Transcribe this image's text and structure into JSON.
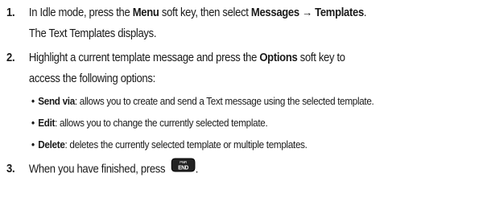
{
  "steps": [
    {
      "number": "1.",
      "line1": {
        "pre": "In Idle mode, press the ",
        "b1": "Menu",
        "mid": " soft key, then select ",
        "b2": "Messages",
        "arrow": " → ",
        "b3": "Templates",
        "end": "."
      },
      "line2": "The Text Templates displays."
    },
    {
      "number": "2.",
      "line1": {
        "pre": "Highlight a current template message and press the ",
        "b1": "Options",
        "end": " soft key to"
      },
      "line2": "access the following options:",
      "bullets": [
        {
          "term": "Send via",
          "desc": ": allows you to create and send a Text message using the selected template."
        },
        {
          "term": "Edit",
          "desc": ": allows you to change the currently selected template."
        },
        {
          "term": "Delete",
          "desc": ": deletes the currently selected template or multiple templates."
        }
      ]
    },
    {
      "number": "3.",
      "line1": {
        "pre": "When you have finished, press ",
        "end": "."
      },
      "key_icon": {
        "name": "end-key-icon",
        "top_label": "PWR",
        "bottom_label": "END"
      }
    }
  ],
  "bullet_glyph": "•"
}
